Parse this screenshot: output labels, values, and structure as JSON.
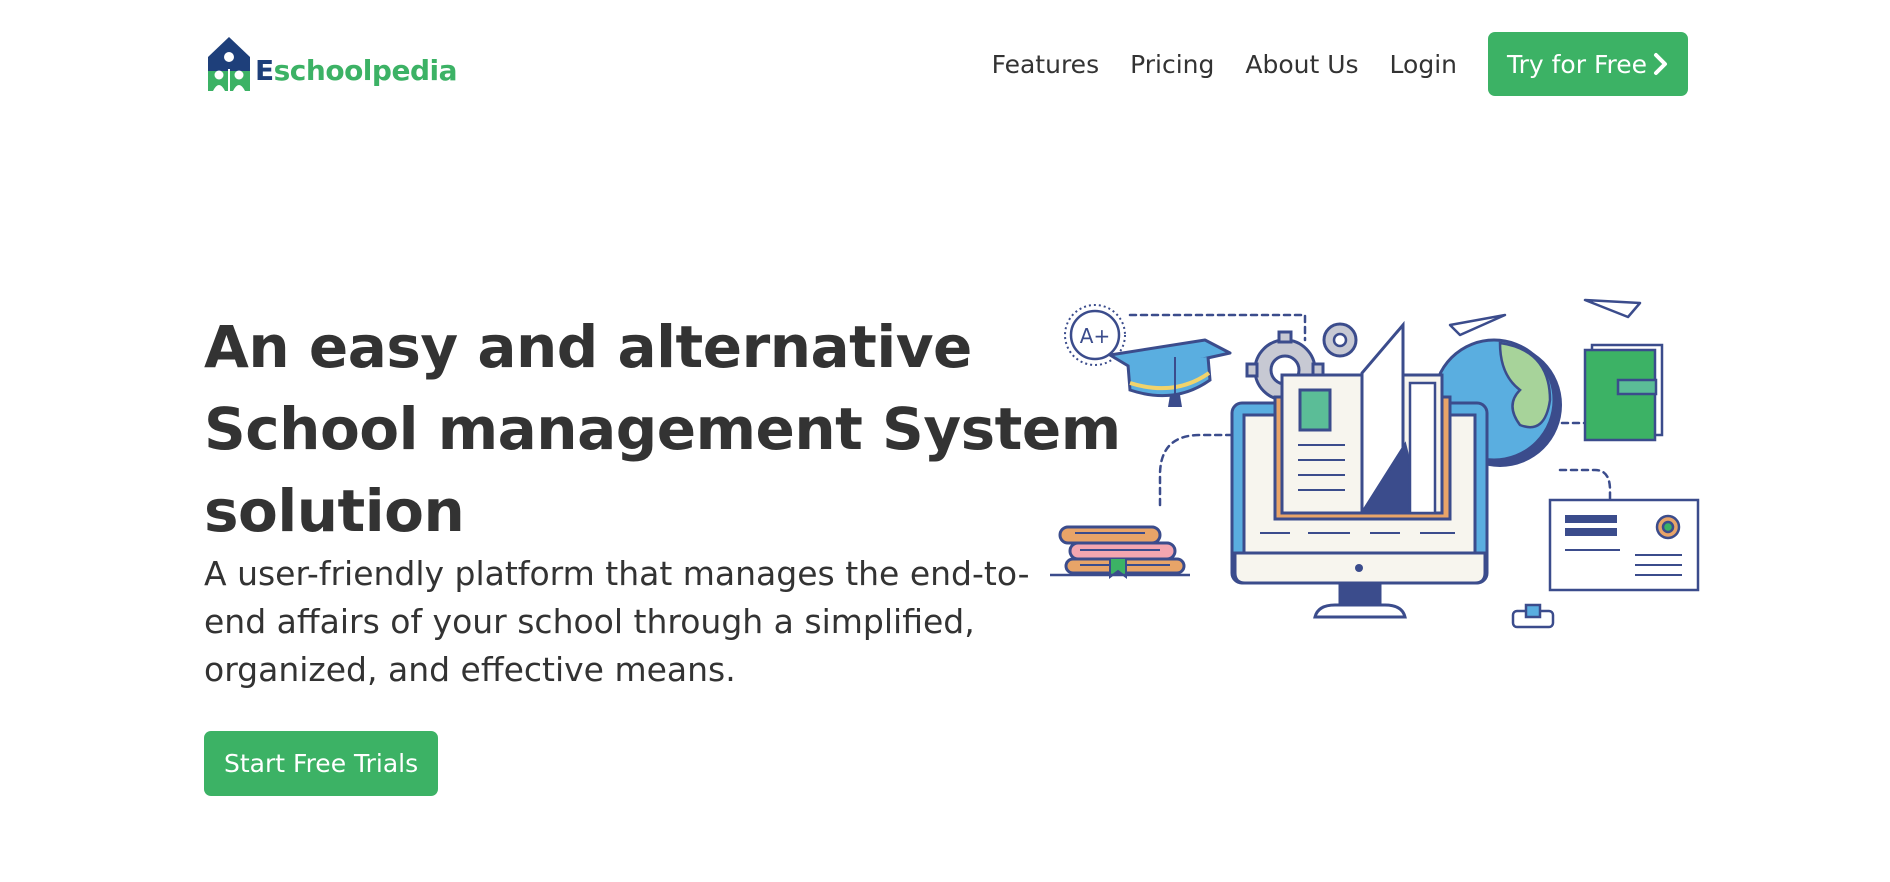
{
  "header": {
    "logo": {
      "text_prefix": "E",
      "text_rest": "schoolpedia"
    },
    "nav": [
      "Features",
      "Pricing",
      "About Us",
      "Login"
    ],
    "cta_label": "Try for Free"
  },
  "hero": {
    "title_lines": [
      "An easy and alternative",
      "School management System",
      "solution"
    ],
    "subtitle_lines": [
      "A user-friendly platform that manages the end-to-",
      "end affairs of your school through a simplified,",
      "organized, and effective means."
    ],
    "button_label": "Start Free Trials",
    "illustration": {
      "badge_text": "A+"
    }
  },
  "colors": {
    "brand_green": "#3cb265",
    "brand_navy": "#1e3f7a",
    "text": "#333333",
    "illustration_blue": "#5aaee0",
    "illustration_outline": "#3b4c8c",
    "illustration_orange": "#e8a468"
  }
}
